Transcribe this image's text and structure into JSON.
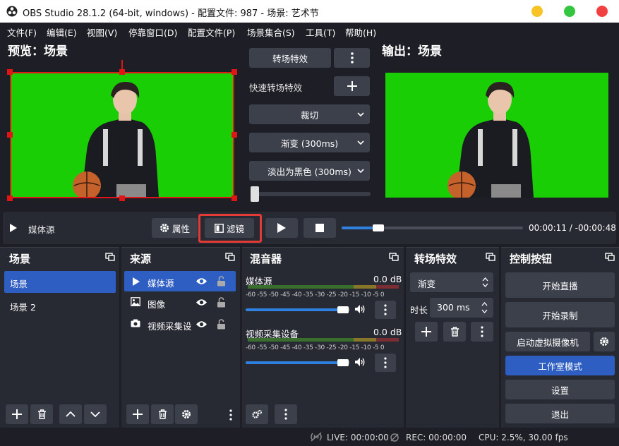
{
  "window": {
    "title": "OBS Studio 28.1.2 (64-bit, windows) - 配置文件: 987 - 场景: 艺术节"
  },
  "menu": [
    "文件(F)",
    "编辑(E)",
    "视图(V)",
    "停靠窗口(D)",
    "配置文件(P)",
    "场景集合(S)",
    "工具(T)",
    "帮助(H)"
  ],
  "preview": {
    "title": "预览：场景"
  },
  "output": {
    "title": "输出：场景"
  },
  "transition_panel": {
    "transition_button": "转场特效",
    "quick_label": "快速转场特效",
    "items": [
      "裁切",
      "渐变 (300ms)",
      "淡出为黑色 (300ms)"
    ]
  },
  "media_bar": {
    "source_name": "媒体源",
    "properties": "属性",
    "filters": "滤镜",
    "current_time": "00:00:11",
    "separator": "/",
    "remaining_time": "-00:00:48",
    "progress": 0.17
  },
  "scenes": {
    "title": "场景",
    "items": [
      "场景",
      "场景 2"
    ],
    "selected": 0
  },
  "sources": {
    "title": "来源",
    "items": [
      "媒体源",
      "图像",
      "视频采集设"
    ],
    "selected": 0
  },
  "mixer": {
    "title": "混音器",
    "ticks": "-60 -55 -50 -45 -40 -35 -30 -25 -20 -15 -10 -5 0",
    "channels": [
      {
        "name": "媒体源",
        "db": "0.0 dB",
        "volume": 0.96
      },
      {
        "name": "视频采集设备",
        "db": "0.0 dB",
        "volume": 0.96
      }
    ]
  },
  "transitions_dock": {
    "title": "转场特效",
    "selected": "渐变",
    "duration_label": "时长",
    "duration_value": "300 ms"
  },
  "controls": {
    "title": "控制按钮",
    "start_stream": "开始直播",
    "start_record": "开始录制",
    "virtual_cam": "启动虚拟摄像机",
    "studio_mode": "工作室模式",
    "settings": "设置",
    "exit": "退出"
  },
  "status": {
    "live": "LIVE: 00:00:00",
    "rec": "REC: 00:00:00",
    "cpu": "CPU: 2.5%, 30.00 fps"
  },
  "colors": {
    "accent": "#2f5ec2",
    "highlight_border": "#e53935",
    "chroma": "#19ce04"
  }
}
